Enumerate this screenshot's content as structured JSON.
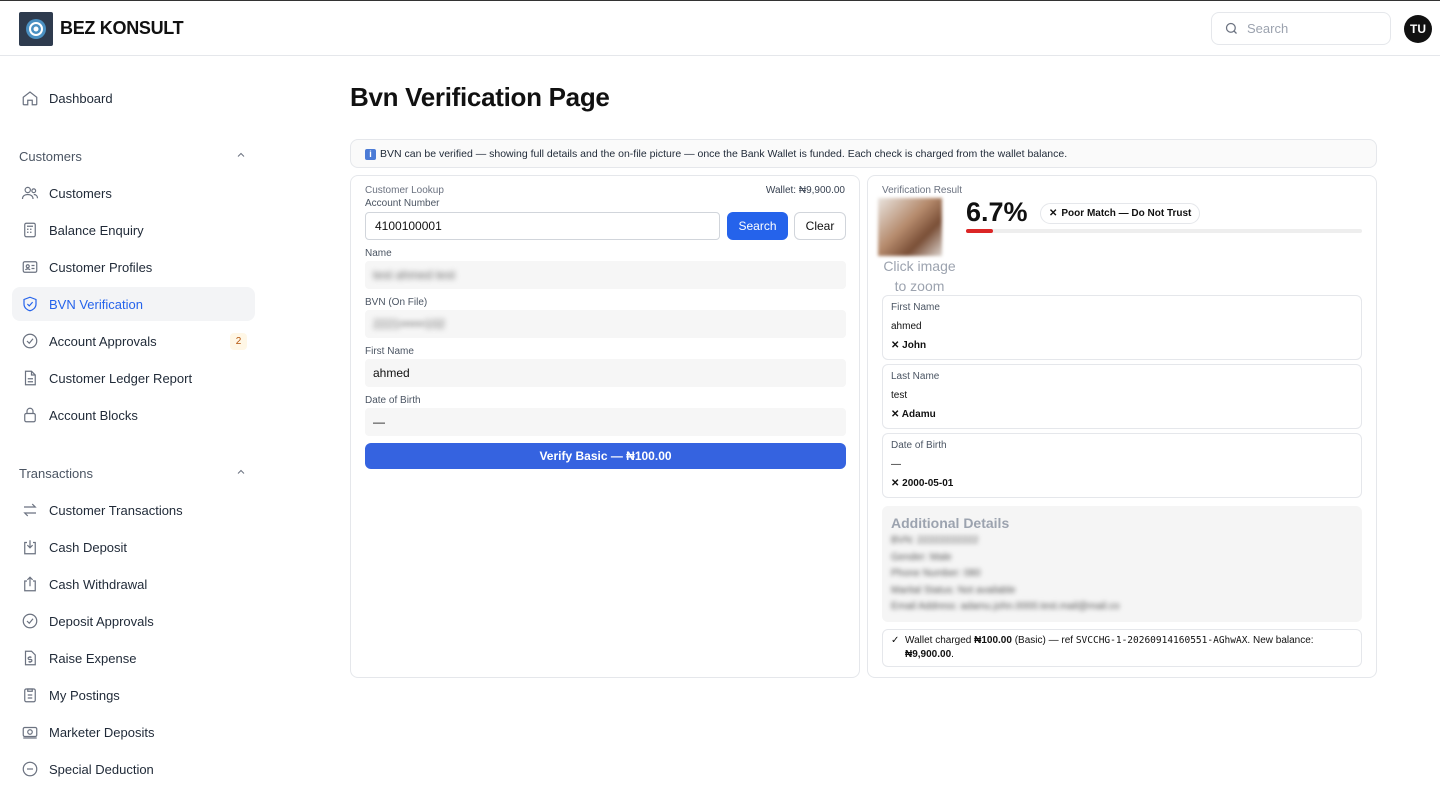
{
  "header": {
    "brand": "BEZ KONSULT",
    "search_placeholder": "Search",
    "avatar_initials": "TU"
  },
  "sidebar": {
    "dashboard": "Dashboard",
    "groups": [
      {
        "label": "Customers",
        "items": [
          "Customers",
          "Balance Enquiry",
          "Customer Profiles",
          "BVN Verification",
          "Account Approvals",
          "Customer Ledger Report",
          "Account Blocks"
        ]
      },
      {
        "label": "Transactions",
        "items": [
          "Customer Transactions",
          "Cash Deposit",
          "Cash Withdrawal",
          "Deposit Approvals",
          "Raise Expense",
          "My Postings",
          "Marketer Deposits",
          "Special Deduction"
        ]
      }
    ],
    "active": "BVN Verification",
    "approvals_badge": "2"
  },
  "page": {
    "title": "Bvn Verification Page"
  },
  "notice": {
    "icon": "info-icon",
    "text": "BVN can be verified — showing full details and the on-file picture — once the Bank Wallet is funded. Each check is charged from the wallet balance."
  },
  "lookup": {
    "section": "Customer Lookup",
    "wallet": "Wallet: ₦9,900.00",
    "account_label": "Account Number",
    "account_value": "4100100001",
    "search_btn": "Search",
    "clear_btn": "Clear",
    "name_label": "Name",
    "name_value": "test ahmed test",
    "bvn_label": "BVN (On File)",
    "bvn_value": "2221••••••102",
    "first_name_label": "First Name",
    "first_name_value": "ahmed",
    "dob_label": "Date of Birth",
    "dob_value": "—",
    "verify_btn": "Verify Basic — ₦100.00"
  },
  "result": {
    "section": "Verification Result",
    "score": "6.7%",
    "score_fraction": 0.067,
    "match_badge": "Poor Match — Do Not Trust",
    "photo_hint_1": "Click image",
    "photo_hint_2": "to zoom",
    "fields": [
      {
        "label": "First Name",
        "on_file": "ahmed",
        "returned": "John"
      },
      {
        "label": "Last Name",
        "on_file": "test",
        "returned": "Adamu"
      },
      {
        "label": "Date of Birth",
        "on_file": "—",
        "returned": "2000-05-01"
      }
    ],
    "additional_title": "Additional Details",
    "additional_rows": [
      {
        "k": "BVN",
        "v": "22222222222"
      },
      {
        "k": "Gender",
        "v": "Male"
      },
      {
        "k": "Phone Number",
        "v": "080"
      },
      {
        "k": "Marital Status",
        "v": "Not available"
      },
      {
        "k": "Email Address",
        "v": "adamu.john.0000.test.mail@mail.co"
      }
    ],
    "charge_pre": "Wallet charged ",
    "charge_amount": "₦100.00",
    "charge_mid": " (Basic) — ref ",
    "charge_ref": "SVCCHG-1-20260914160551-AGhwAX",
    "charge_post": ". New balance:",
    "charge_balance": "₦9,900.00",
    "charge_end": "."
  },
  "colors": {
    "accent": "#2563eb"
  }
}
